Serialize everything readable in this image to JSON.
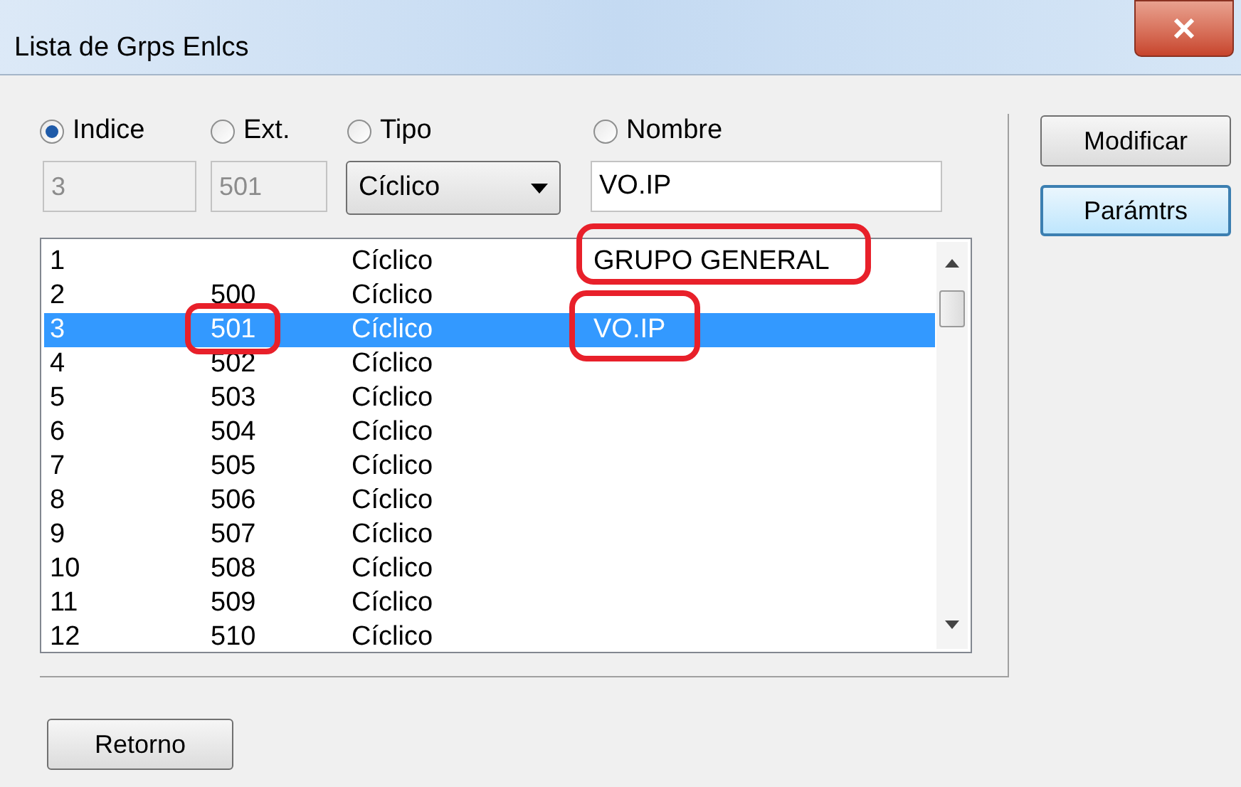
{
  "window": {
    "title": "Lista de Grps Enlcs"
  },
  "search_by": [
    {
      "label": "Indice",
      "selected": true
    },
    {
      "label": "Ext.",
      "selected": false
    },
    {
      "label": "Tipo",
      "selected": false
    },
    {
      "label": "Nombre",
      "selected": false
    }
  ],
  "fields": {
    "indice": "3",
    "ext": "501",
    "tipo": "Cíclico",
    "nombre": "VO.IP"
  },
  "buttons": [
    "Modificar",
    "Parámtrs"
  ],
  "rows": [
    {
      "index": "1",
      "ext": "",
      "type": "Cíclico",
      "name": "GRUPO GENERAL",
      "selected": false
    },
    {
      "index": "2",
      "ext": "500",
      "type": "Cíclico",
      "name": "",
      "selected": false
    },
    {
      "index": "3",
      "ext": "501",
      "type": "Cíclico",
      "name": "VO.IP",
      "selected": true
    },
    {
      "index": "4",
      "ext": "502",
      "type": "Cíclico",
      "name": "",
      "selected": false
    },
    {
      "index": "5",
      "ext": "503",
      "type": "Cíclico",
      "name": "",
      "selected": false
    },
    {
      "index": "6",
      "ext": "504",
      "type": "Cíclico",
      "name": "",
      "selected": false
    },
    {
      "index": "7",
      "ext": "505",
      "type": "Cíclico",
      "name": "",
      "selected": false
    },
    {
      "index": "8",
      "ext": "506",
      "type": "Cíclico",
      "name": "",
      "selected": false
    },
    {
      "index": "9",
      "ext": "507",
      "type": "Cíclico",
      "name": "",
      "selected": false
    },
    {
      "index": "10",
      "ext": "508",
      "type": "Cíclico",
      "name": "",
      "selected": false
    },
    {
      "index": "11",
      "ext": "509",
      "type": "Cíclico",
      "name": "",
      "selected": false
    },
    {
      "index": "12",
      "ext": "510",
      "type": "Cíclico",
      "name": "",
      "selected": false
    }
  ],
  "footer_button": "Retorno"
}
